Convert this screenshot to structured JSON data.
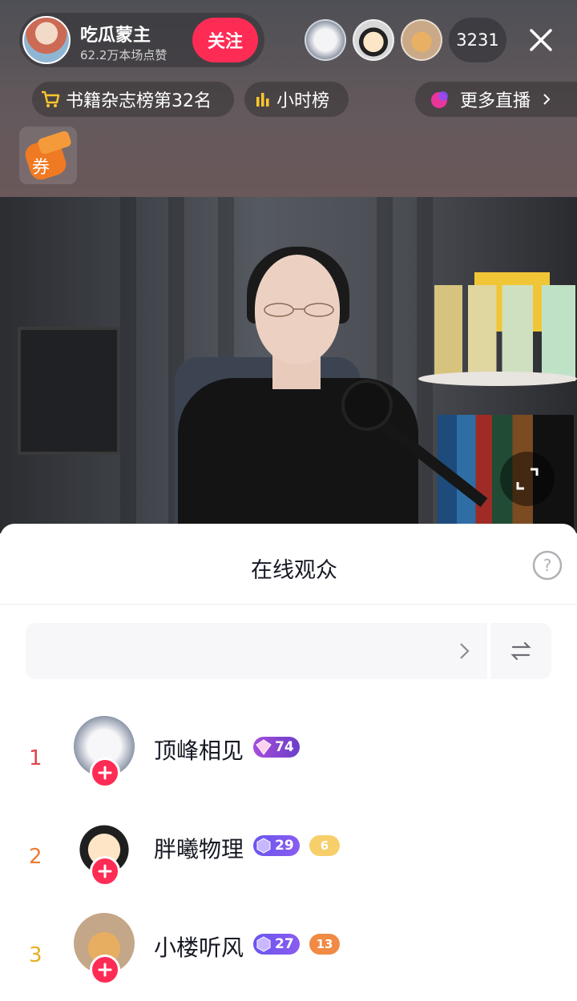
{
  "header": {
    "host_name": "吃瓜蒙主",
    "host_likes": "62.2万本场点赞",
    "follow_label": "关注",
    "viewer_count": "3231"
  },
  "chips": {
    "rank_label": "书籍杂志榜第32名",
    "hourly_label": "小时榜",
    "more_live_label": "更多直播"
  },
  "sheet": {
    "title": "在线观众"
  },
  "viewers": [
    {
      "rank": "1",
      "name": "顶峰相见",
      "level": "74",
      "fan_level": ""
    },
    {
      "rank": "2",
      "name": "胖曦物理",
      "level": "29",
      "fan_level": "6"
    },
    {
      "rank": "3",
      "name": "小楼听风",
      "level": "27",
      "fan_level": "13"
    }
  ],
  "colors": {
    "accent": "#fe2c55",
    "rank1": "#e0434b",
    "rank2": "#ef7a34",
    "rank3": "#e6b021",
    "level_badge": "#6f5cf0"
  }
}
